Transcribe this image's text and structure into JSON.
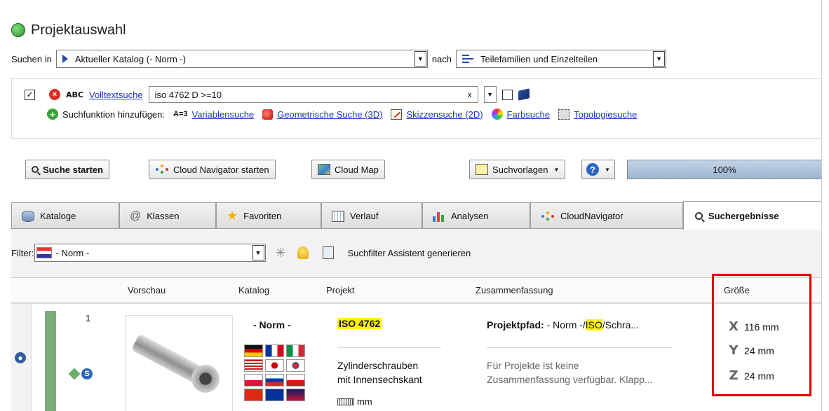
{
  "window": {
    "title": "Projektauswahl"
  },
  "search_scope": {
    "label": "Suchen in",
    "value": "Aktueller Katalog (- Norm -)",
    "nach_label": "nach",
    "mode_value": "Teilefamilien und Einzelteilen"
  },
  "criteria": {
    "abc_label": "ABC",
    "fulltext_link": "Volltextsuche",
    "query_value": "iso 4762 D >=10",
    "clear_symbol": "x",
    "add_label": "Suchfunktion hinzufügen:",
    "a3_label": "A=3",
    "links": {
      "variable": "Variablensuche",
      "geometric": "Geometrische Suche (3D)",
      "sketch": "Skizzensuche (2D)",
      "color": "Farbsuche",
      "topology": "Topologiesuche"
    }
  },
  "toolbar": {
    "search_start": "Suche starten",
    "cloud_navigator": "Cloud Navigator starten",
    "cloud_map": "Cloud Map",
    "templates": "Suchvorlagen",
    "help": "?",
    "progress_text": "100%",
    "progress_value": 1.0
  },
  "tabs": [
    {
      "label": "Kataloge",
      "icon": "database-icon"
    },
    {
      "label": "Klassen",
      "icon": "at-icon"
    },
    {
      "label": "Favoriten",
      "icon": "star-icon"
    },
    {
      "label": "Verlauf",
      "icon": "calendar-icon"
    },
    {
      "label": "Analysen",
      "icon": "bar-chart-icon"
    },
    {
      "label": "CloudNavigator",
      "icon": "cloud-dots-icon"
    },
    {
      "label": "Suchergebnisse",
      "icon": "search-icon",
      "active": true
    }
  ],
  "filter": {
    "label": "Filter:",
    "value": "- Norm -",
    "assistant_label": "Suchfilter Assistent generieren"
  },
  "table": {
    "headers": {
      "preview": "Vorschau",
      "catalog": "Katalog",
      "project": "Projekt",
      "summary": "Zusammenfassung",
      "size": "Größe"
    },
    "rows": [
      {
        "index": "1",
        "catalog": "- Norm -",
        "project_title_a": "ISO",
        "project_title_b": "4762",
        "project_desc_1": "Zylinderschrauben",
        "project_desc_2": "mit Innensechskant",
        "unit": "mm",
        "path_label": "Projektpfad:",
        "path_pre": " - Norm -/",
        "path_hl": "ISO",
        "path_post": "/Schra...",
        "summary_1": "Für Projekte ist keine",
        "summary_2": "Zusammenfassung verfügbar. Klapp...",
        "size_x": "116 mm",
        "size_y": "24 mm",
        "size_z": "24 mm"
      }
    ]
  },
  "colors": {
    "highlight": "#fff200",
    "size_box_border": "#e00000",
    "row_bar": "#79ae7b"
  }
}
